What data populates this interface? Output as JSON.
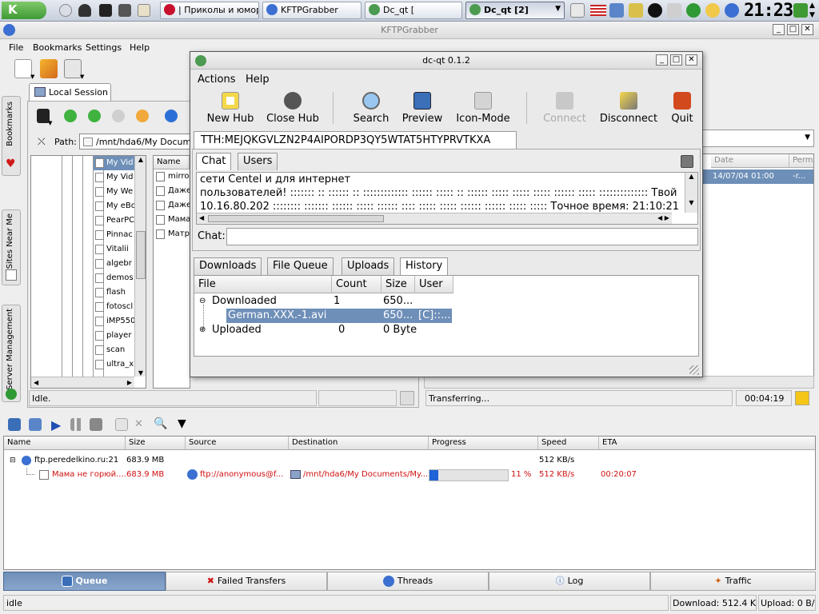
{
  "taskbar": {
    "items": [
      {
        "label": "| Приколы и юмор"
      },
      {
        "label": "KFTPGrabber"
      },
      {
        "label": "Dc_qt ["
      },
      {
        "label": "Dc_qt [2]"
      }
    ],
    "clock": "21:23"
  },
  "main": {
    "title": "KFTPGrabber",
    "menu": [
      "File",
      "Bookmarks",
      "Settings",
      "Help"
    ],
    "local_session_tab": "Local Session",
    "path_label": "Path:",
    "path_value": "/mnt/hda6/My Documen",
    "tree_items": [
      "My Vid",
      "My Vid",
      "My We",
      "My eBo",
      "PearPC",
      "Pinnac",
      "Vitalii",
      "algebr",
      "demos",
      "flash",
      "fotoscl",
      "iMP550",
      "player",
      "scan",
      "ultra_x"
    ],
    "file_header": "Name",
    "file_items": [
      "mirror",
      "Даже",
      "Даже",
      "Мама",
      "Матр"
    ],
    "left_status": "Idle.",
    "remote_headers": {
      "date": "Date",
      "perm": "Perm"
    },
    "remote_row": {
      "date": "14/07/04 01:00",
      "perm": "-r..."
    },
    "right_status": "Transferring...",
    "right_time": "00:04:19",
    "side_tabs": [
      "Bookmarks",
      "Sites Near Me",
      "Server Management"
    ]
  },
  "queue": {
    "headers": [
      "Name",
      "Size",
      "Source",
      "Destination",
      "Progress",
      "Speed",
      "ETA"
    ],
    "site_row": {
      "name": "ftp.peredelkino.ru:21",
      "size": "683.9 MB",
      "speed": "512 KB/s"
    },
    "file_row": {
      "name": "Мама не горюй....",
      "size": "683.9 MB",
      "source": "ftp://anonymous@f...",
      "dest": "/mnt/hda6/My Documents/My...",
      "progress_text": "11 %",
      "progress": 0.11,
      "speed": "512 KB/s",
      "eta": "00:20:07"
    },
    "bottom_tabs": [
      "Queue",
      "Failed Transfers",
      "Threads",
      "Log",
      "Traffic"
    ],
    "status_left": "idle",
    "status_download": "Download: 512.4 KB/s",
    "status_upload": "Upload: 0 B/s"
  },
  "dc": {
    "title": "dc-qt 0.1.2",
    "menu": [
      "Actions",
      "Help"
    ],
    "toolbar": [
      {
        "label": "New Hub",
        "enabled": true
      },
      {
        "label": "Close Hub",
        "enabled": true
      },
      {
        "label": "Search",
        "enabled": true
      },
      {
        "label": "Preview",
        "enabled": true
      },
      {
        "label": "Icon-Mode",
        "enabled": true
      },
      {
        "label": "Connect",
        "enabled": false
      },
      {
        "label": "Disconnect",
        "enabled": true
      },
      {
        "label": "Quit",
        "enabled": true
      }
    ],
    "tth_tab": "TTH:MEJQKGVLZN2P4AIPORDP3QY5WTAT5HTYPRVTKXA",
    "chat_tabs": [
      "Chat",
      "Users"
    ],
    "chat_lines": [
      "сети Centel и для интернет",
      "пользователей! ::::::: :: :::::: :: ::::::::::::: :::::: ::::: :: :::::: ::::: ::::: ::::: :::::: ::::: ::::::::::::::  Твой ip:",
      "10.16.80.202 :::::::: ::::::: :::::: ::::: :::::: :::: ::::: ::::: :::::: :::::: ::::: :::::  Точное время: 21:10:21"
    ],
    "chat_label": "Chat:",
    "transfer_tabs": [
      "Downloads",
      "File Queue",
      "Uploads",
      "History"
    ],
    "history_headers": [
      "File",
      "Count",
      "Size",
      "User"
    ],
    "history_rows": [
      {
        "file": "Downloaded",
        "count": "1",
        "size": "650...",
        "user": ""
      },
      {
        "file": "German.XXX.-1.avi",
        "count": "",
        "size": "650...",
        "user": "[C]::..."
      },
      {
        "file": "Uploaded",
        "count": "0",
        "size": "0 Byte",
        "user": ""
      }
    ]
  }
}
